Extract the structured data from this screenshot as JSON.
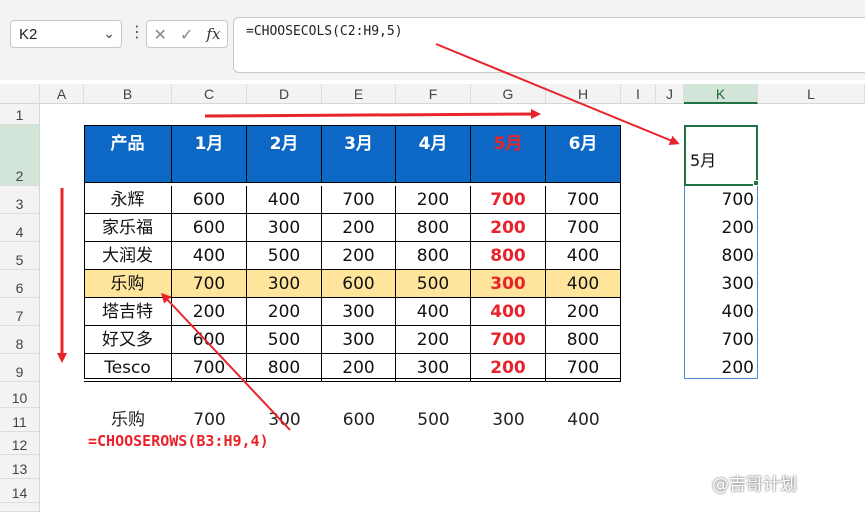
{
  "namebox": {
    "value": "K2"
  },
  "formula_bar": {
    "cancel_glyph": "✕",
    "confirm_glyph": "✓",
    "fx_label": "fx",
    "formula": "=CHOOSECOLS(C2:H9,5)"
  },
  "columns": [
    "A",
    "B",
    "C",
    "D",
    "E",
    "F",
    "G",
    "H",
    "I",
    "J",
    "K",
    "L"
  ],
  "rows": [
    "1",
    "2",
    "3",
    "4",
    "5",
    "6",
    "7",
    "8",
    "9",
    "10",
    "11",
    "12",
    "13",
    "14"
  ],
  "table": {
    "headers": [
      "产品",
      "1月",
      "2月",
      "3月",
      "4月",
      "5月",
      "6月"
    ],
    "rows": [
      [
        "永辉",
        "600",
        "400",
        "700",
        "200",
        "700",
        "700"
      ],
      [
        "家乐福",
        "600",
        "300",
        "200",
        "800",
        "200",
        "700"
      ],
      [
        "大润发",
        "400",
        "500",
        "200",
        "800",
        "800",
        "400"
      ],
      [
        "乐购",
        "700",
        "300",
        "600",
        "500",
        "300",
        "400"
      ],
      [
        "塔吉特",
        "200",
        "200",
        "300",
        "400",
        "400",
        "200"
      ],
      [
        "好又多",
        "600",
        "500",
        "300",
        "200",
        "700",
        "800"
      ],
      [
        "Tesco",
        "700",
        "800",
        "200",
        "300",
        "200",
        "700"
      ]
    ]
  },
  "result_row": [
    "乐购",
    "700",
    "300",
    "600",
    "500",
    "300",
    "400"
  ],
  "result_formula": "=CHOOSEROWS(B3:H9,4)",
  "k_column": {
    "header": "5月",
    "values": [
      "700",
      "200",
      "800",
      "300",
      "400",
      "700",
      "200"
    ]
  },
  "watermark": "@吉哥计划",
  "colors": {
    "header_bg": "#0d67c4",
    "highlight": "#ffe49c",
    "accent_red": "#e8242a",
    "selection_green": "#217346"
  }
}
